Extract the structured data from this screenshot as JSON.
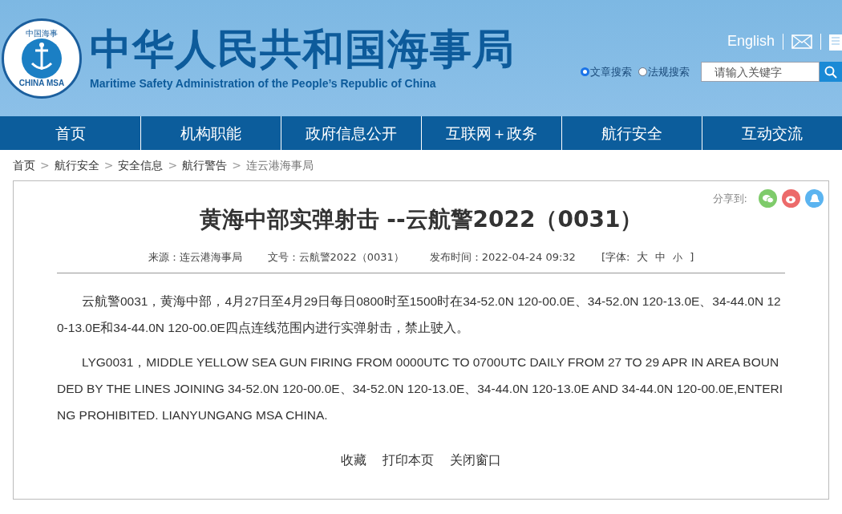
{
  "header": {
    "logo": {
      "top_text": "中国海事",
      "bottom_text": "CHINA MSA"
    },
    "title": "中华人民共和国海事局",
    "subtitle": "Maritime Safety Administration of the People’s Republic of China",
    "language_link": "English",
    "search_scopes": [
      {
        "label": "文章搜索",
        "selected": true
      },
      {
        "label": "法规搜索",
        "selected": false
      }
    ],
    "search": {
      "placeholder": "请输入关键字"
    }
  },
  "nav": [
    "首页",
    "机构职能",
    "政府信息公开",
    "互联网＋政务",
    "航行安全",
    "互动交流"
  ],
  "breadcrumb": {
    "separator": ">",
    "items": [
      "首页",
      "航行安全",
      "安全信息",
      "航行警告",
      "连云港海事局"
    ]
  },
  "article": {
    "share_label": "分享到:",
    "title": "黄海中部实弹射击 --云航警2022（0031）",
    "meta": [
      "来源：连云港海事局",
      "文号：云航警2022（0031）",
      "发布时间：2022-04-24 09:32"
    ],
    "font_size": {
      "label": "[字体:",
      "options": [
        "大",
        "中",
        "小"
      ],
      "close": "]"
    },
    "paragraphs": [
      "云航警0031，黄海中部，4月27日至4月29日每日0800时至1500时在34-52.0N 120-00.0E、34-52.0N 120-13.0E、34-44.0N 120-13.0E和34-44.0N 120-00.0E四点连线范围内进行实弹射击，禁止驶入。",
      "LYG0031，MIDDLE YELLOW SEA GUN FIRING FROM 0000UTC TO 0700UTC DAILY  FROM 27 TO 29 APR IN AREA BOUNDED BY THE LINES JOINING 34-52.0N 120-00.0E、34-52.0N 120-13.0E、34-44.0N 120-13.0E AND 34-44.0N 120-00.0E,ENTERING PROHIBITED. LIANYUNGANG MSA CHINA."
    ],
    "actions": [
      "收藏",
      "打印本页",
      "关闭窗口"
    ]
  }
}
